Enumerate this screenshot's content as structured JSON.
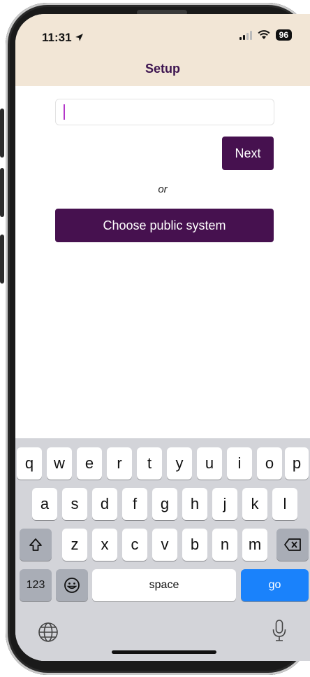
{
  "status_bar": {
    "time": "11:31",
    "battery": "96"
  },
  "nav": {
    "title": "Setup"
  },
  "form": {
    "input_value": "",
    "next_label": "Next",
    "or_label": "or",
    "public_label": "Choose public system"
  },
  "keyboard": {
    "row1": [
      "q",
      "w",
      "e",
      "r",
      "t",
      "y",
      "u",
      "i",
      "o",
      "p"
    ],
    "row2": [
      "a",
      "s",
      "d",
      "f",
      "g",
      "h",
      "j",
      "k",
      "l"
    ],
    "row3": [
      "z",
      "x",
      "c",
      "v",
      "b",
      "n",
      "m"
    ],
    "numbers_label": "123",
    "space_label": "space",
    "go_label": "go",
    "icons": [
      "shift-icon",
      "delete-icon",
      "emoji-icon",
      "globe-icon",
      "microphone-icon"
    ]
  },
  "colors": {
    "accent": "#46114f",
    "header_bg": "#f2e6d6",
    "keyboard_bg": "#d3d4d9",
    "go_key": "#1a82fb"
  }
}
